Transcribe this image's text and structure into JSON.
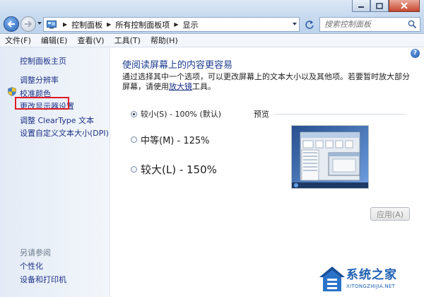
{
  "address": {
    "crumbs": [
      "控制面板",
      "所有控制面板项",
      "显示"
    ],
    "search_placeholder": "搜索控制面板"
  },
  "menu": [
    "文件(F)",
    "编辑(E)",
    "查看(V)",
    "工具(T)",
    "帮助(H)"
  ],
  "sidebar": {
    "home": "控制面板主页",
    "items": [
      "调整分辨率",
      "校准颜色",
      "更改显示器设置",
      "调整 ClearType 文本",
      "设置自定义文本大小(DPI)"
    ],
    "see_also_title": "另请参阅",
    "see_also": [
      "个性化",
      "设备和打印机"
    ]
  },
  "main": {
    "title": "使阅读屏幕上的内容更容易",
    "desc_text": "通过选择其中一个选项，可以更改屏幕上的文本大小以及其他项。若要暂时放大部分屏幕，请使用",
    "desc_link": "放大镜",
    "desc_tail": "工具。",
    "options": [
      {
        "label": "较小(S) - 100% (默认)",
        "selected": true
      },
      {
        "label": "中等(M) - 125%",
        "selected": false
      },
      {
        "label": "较大(L) - 150%",
        "selected": false
      }
    ],
    "preview_label": "预览",
    "apply_label": "应用(A)",
    "help_glyph": "?"
  },
  "watermark": {
    "title": "系统之家",
    "url": "XITONGZHIJIA.NET"
  },
  "icons": {
    "back": "back-arrow-icon",
    "forward": "forward-arrow-icon",
    "control_panel": "control-panel-icon",
    "refresh": "refresh-icon",
    "search": "search-icon",
    "shield": "shield-icon",
    "help": "help-icon",
    "minimize": "minimize-icon",
    "maximize": "maximize-icon",
    "close": "close-icon"
  },
  "colors": {
    "link": "#1e3287",
    "title": "#1e3d8f",
    "highlight_box": "#e11b22",
    "watermark": "#1d5fb1"
  }
}
